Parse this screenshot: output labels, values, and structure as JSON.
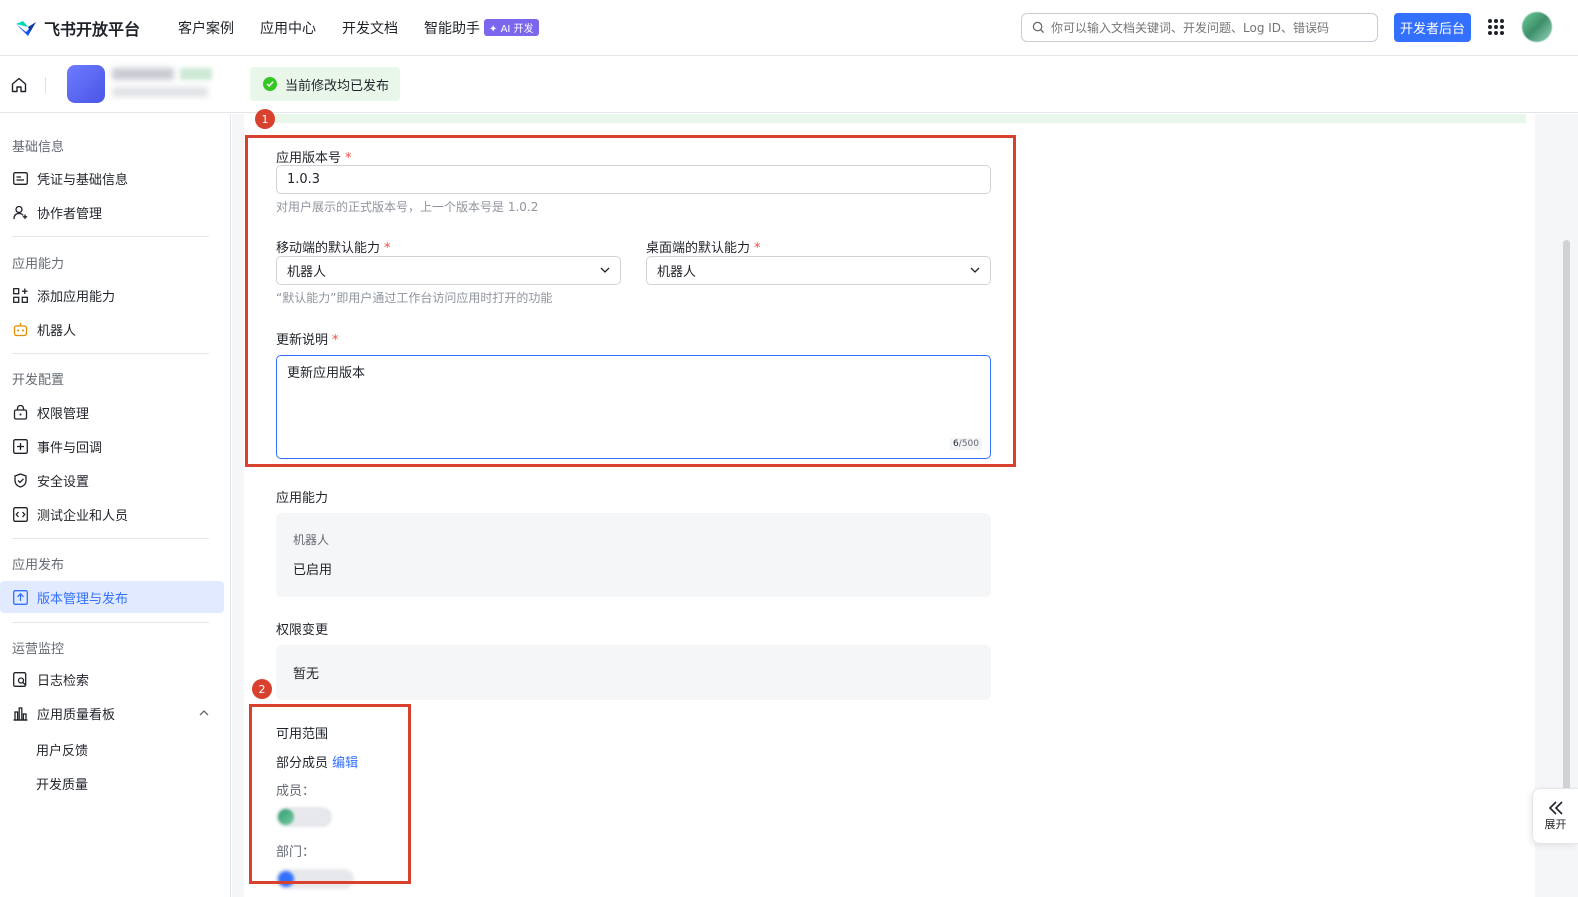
{
  "topnav": {
    "logo_text": "飞书开放平台",
    "links": [
      "客户案例",
      "应用中心",
      "开发文档",
      "智能助手"
    ],
    "ai_badge": "✦ AI 开发",
    "search_placeholder": "你可以输入文档关键词、开发问题、Log ID、错误码",
    "dev_button": "开发者后台"
  },
  "subbar": {
    "status": "当前修改均已发布"
  },
  "sidebar": {
    "sections": [
      {
        "title": "基础信息",
        "items": [
          "凭证与基础信息",
          "协作者管理"
        ]
      },
      {
        "title": "应用能力",
        "items": [
          "添加应用能力",
          "机器人"
        ]
      },
      {
        "title": "开发配置",
        "items": [
          "权限管理",
          "事件与回调",
          "安全设置",
          "测试企业和人员"
        ]
      },
      {
        "title": "应用发布",
        "items": [
          "版本管理与发布"
        ]
      },
      {
        "title": "运营监控",
        "items": [
          "日志检索",
          "应用质量看板"
        ]
      }
    ],
    "sub_items": [
      "用户反馈",
      "开发质量"
    ]
  },
  "form": {
    "version_label": "应用版本号",
    "version_value": "1.0.3",
    "version_hint": "对用户展示的正式版本号，上一个版本号是 1.0.2",
    "mobile_label": "移动端的默认能力",
    "mobile_value": "机器人",
    "desktop_label": "桌面端的默认能力",
    "desktop_value": "机器人",
    "default_hint": "“默认能力”即用户通过工作台访问应用时打开的功能",
    "notes_label": "更新说明",
    "notes_value": "更新应用版本",
    "notes_count": "6",
    "notes_max": "/500",
    "required_mark": "*",
    "capability_label": "应用能力",
    "capability_name": "机器人",
    "capability_status": "已启用",
    "permission_label": "权限变更",
    "permission_value": "暂无",
    "scope_label": "可用范围",
    "scope_value": "部分成员",
    "scope_edit": "编辑",
    "members_label": "成员：",
    "dept_label": "部门："
  },
  "annotations": [
    "1",
    "2"
  ],
  "expand_label": "展开",
  "colors": {
    "accent": "#3370ff",
    "annotation": "#d9412f",
    "success": "#34c724"
  }
}
